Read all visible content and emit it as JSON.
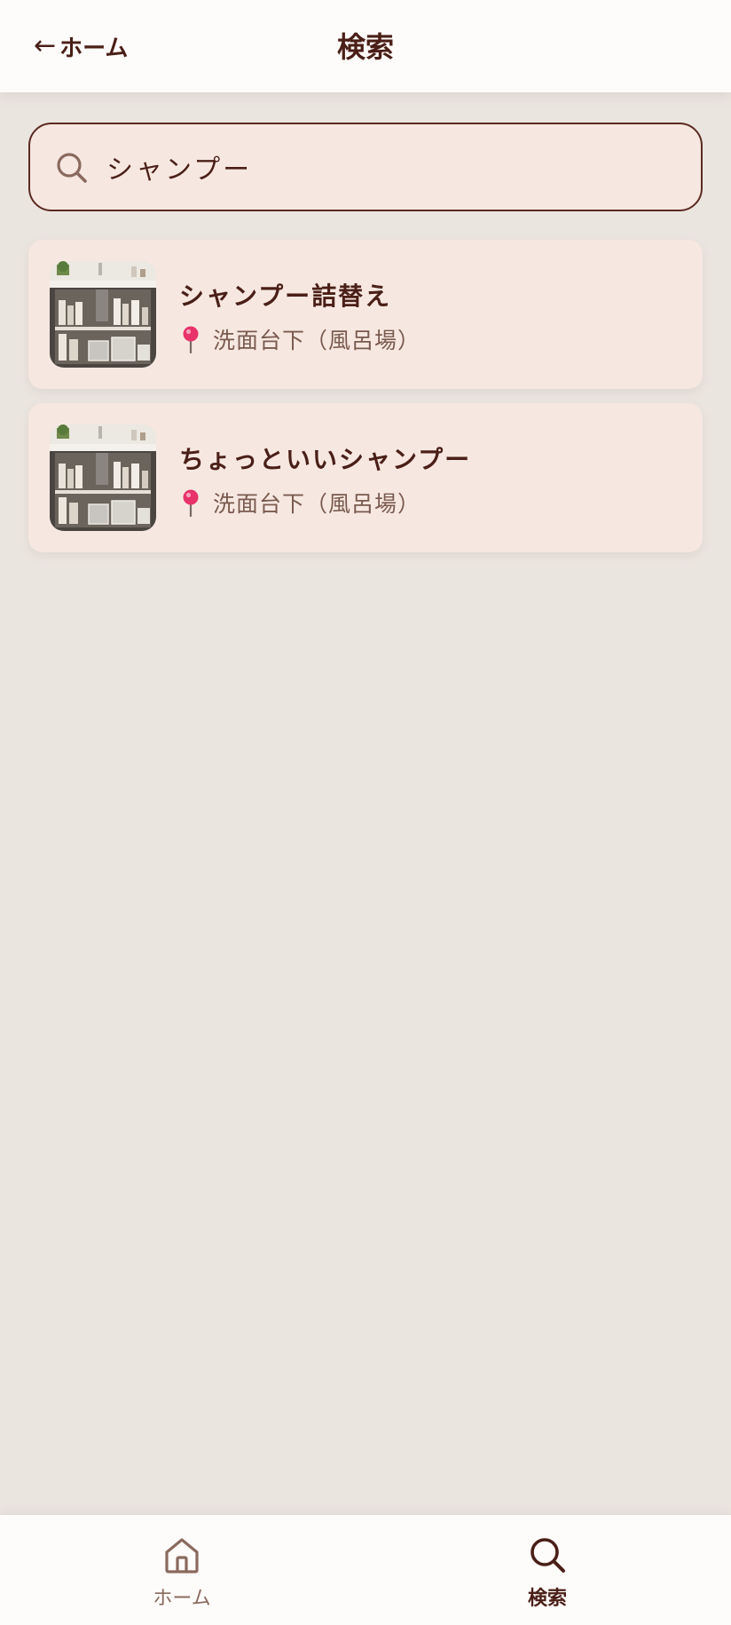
{
  "header": {
    "back_arrow": "←",
    "back_label": "ホーム",
    "title": "検索"
  },
  "search": {
    "value": "シャンプー",
    "placeholder": ""
  },
  "results": [
    {
      "name": "シャンプー詰替え",
      "location": "洗面台下（風呂場）"
    },
    {
      "name": "ちょっといいシャンプー",
      "location": "洗面台下（風呂場）"
    }
  ],
  "bottom_nav": {
    "home_label": "ホーム",
    "search_label": "検索",
    "active": "search"
  },
  "colors": {
    "background": "#ebe5e0",
    "header": "#fefcfa",
    "card": "#f6e8e1",
    "text_primary": "#4a1f17",
    "text_secondary": "#7a5a4e",
    "pin": "#e8326a"
  },
  "icons": {
    "search": "search-icon",
    "location": "pin-icon",
    "home": "home-icon"
  }
}
